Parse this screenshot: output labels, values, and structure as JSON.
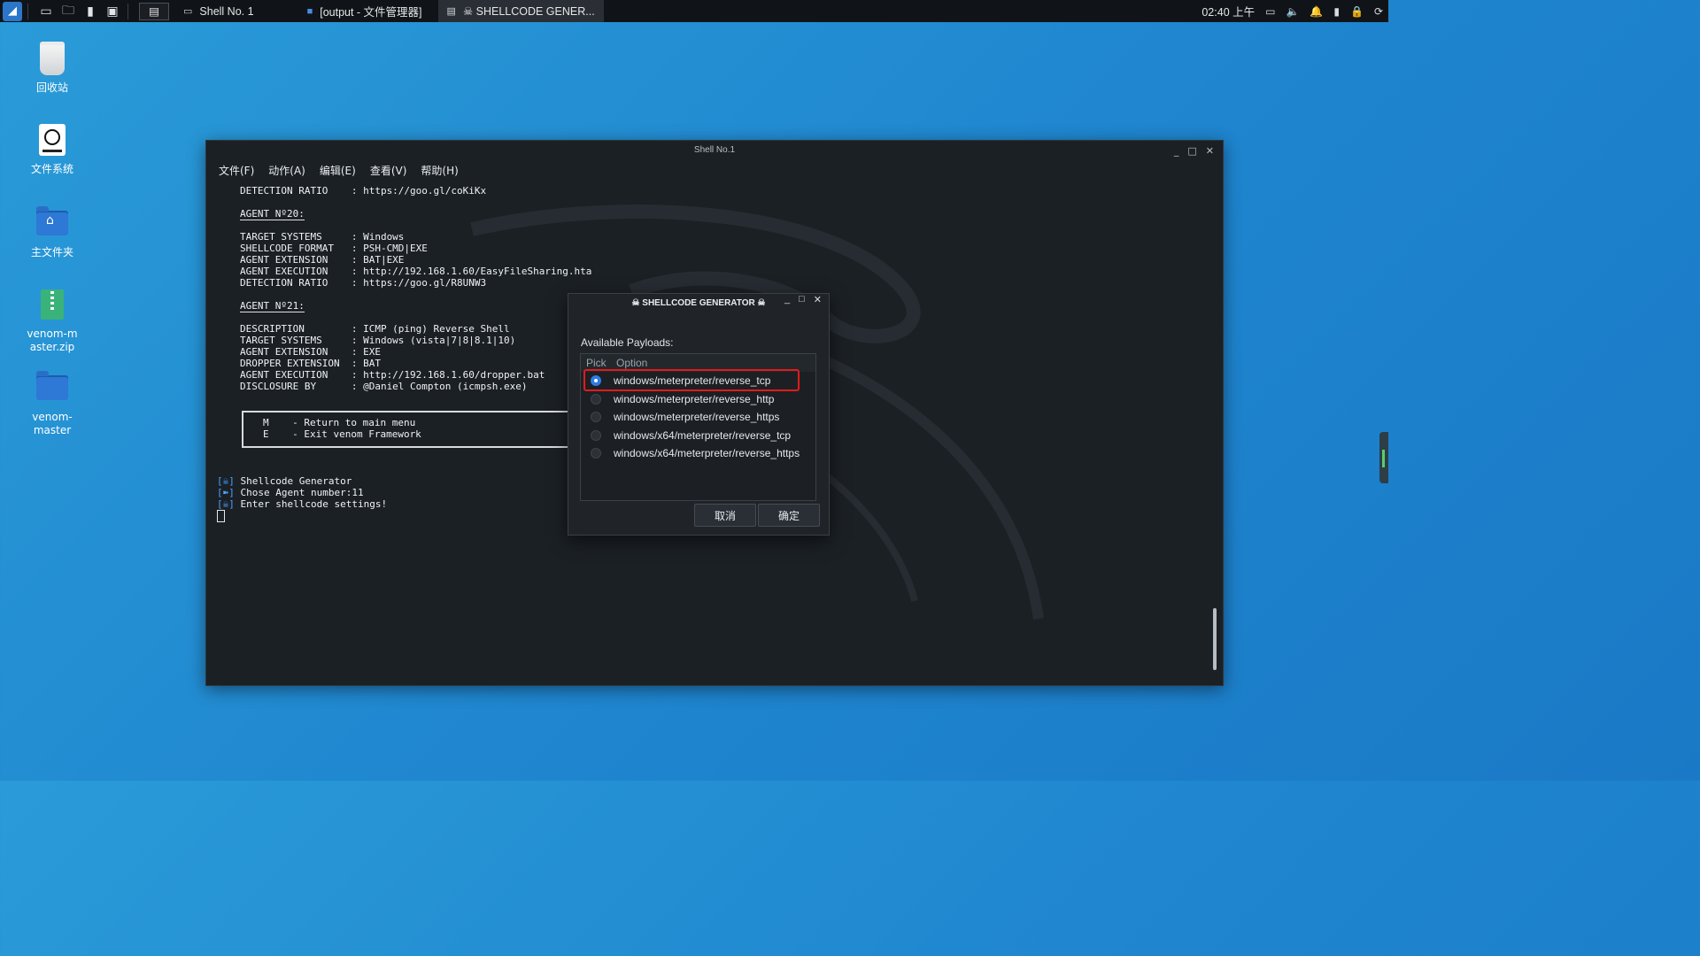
{
  "panel": {
    "tasks": [
      {
        "label": "Shell No. 1",
        "icon": "terminal-icon"
      },
      {
        "label": "[output - 文件管理器]",
        "icon": "folder-icon"
      },
      {
        "label": "☠ SHELLCODE GENER...",
        "icon": "window-icon"
      }
    ],
    "clock": "02:40 上午"
  },
  "desktop": {
    "icons": [
      {
        "label": "回收站",
        "icon": "trash-icon"
      },
      {
        "label": "文件系统",
        "icon": "filesystem-icon"
      },
      {
        "label": "主文件夹",
        "icon": "home-folder-icon"
      },
      {
        "label": "venom-master.zip",
        "icon": "zip-icon"
      },
      {
        "label": "venom-master",
        "icon": "folder-icon"
      }
    ]
  },
  "terminal": {
    "title": "Shell No.1",
    "menu": [
      "文件(F)",
      "动作(A)",
      "编辑(E)",
      "查看(V)",
      "帮助(H)"
    ],
    "lines": [
      "DETECTION RATIO    : https://goo.gl/coKiKx",
      "",
      "AGENT Nº20:",
      "",
      "TARGET SYSTEMS     : Windows",
      "SHELLCODE FORMAT   : PSH-CMD|EXE",
      "AGENT EXTENSION    : BAT|EXE",
      "AGENT EXECUTION    : http://192.168.1.60/EasyFileSharing.hta",
      "DETECTION RATIO    : https://goo.gl/R8UNW3",
      "",
      "AGENT Nº21:",
      "",
      "DESCRIPTION        : ICMP (ping) Reverse Shell",
      "TARGET SYSTEMS     : Windows (vista|7|8|8.1|10)",
      "AGENT EXTENSION    : EXE",
      "DROPPER EXTENSION  : BAT",
      "AGENT EXECUTION    : http://192.168.1.60/dropper.bat",
      "DISCLOSURE BY      : @Daniel Compton (icmpsh.exe)"
    ],
    "menu_box": [
      "M    - Return to main menu",
      "E    - Exit venom Framework"
    ],
    "status": [
      {
        "bracket": "[☠]",
        "text": "Shellcode Generator"
      },
      {
        "bracket": "[➽]",
        "text": "Chose Agent number:11"
      },
      {
        "bracket": "[☠]",
        "text": "Enter shellcode settings!"
      }
    ]
  },
  "dialog": {
    "title": "☠ SHELLCODE GENERATOR ☠",
    "label": "Available Payloads:",
    "columns": [
      "Pick",
      "Option"
    ],
    "options": [
      {
        "label": "windows/meterpreter/reverse_tcp",
        "selected": true
      },
      {
        "label": "windows/meterpreter/reverse_http",
        "selected": false
      },
      {
        "label": "windows/meterpreter/reverse_https",
        "selected": false
      },
      {
        "label": "windows/x64/meterpreter/reverse_tcp",
        "selected": false
      },
      {
        "label": "windows/x64/meterpreter/reverse_https",
        "selected": false
      }
    ],
    "cancel_label": "取消",
    "ok_label": "确定"
  },
  "colors": {
    "accent": "#2f7de1",
    "highlight": "#e21b1b",
    "desktop": "#1f86cf"
  }
}
